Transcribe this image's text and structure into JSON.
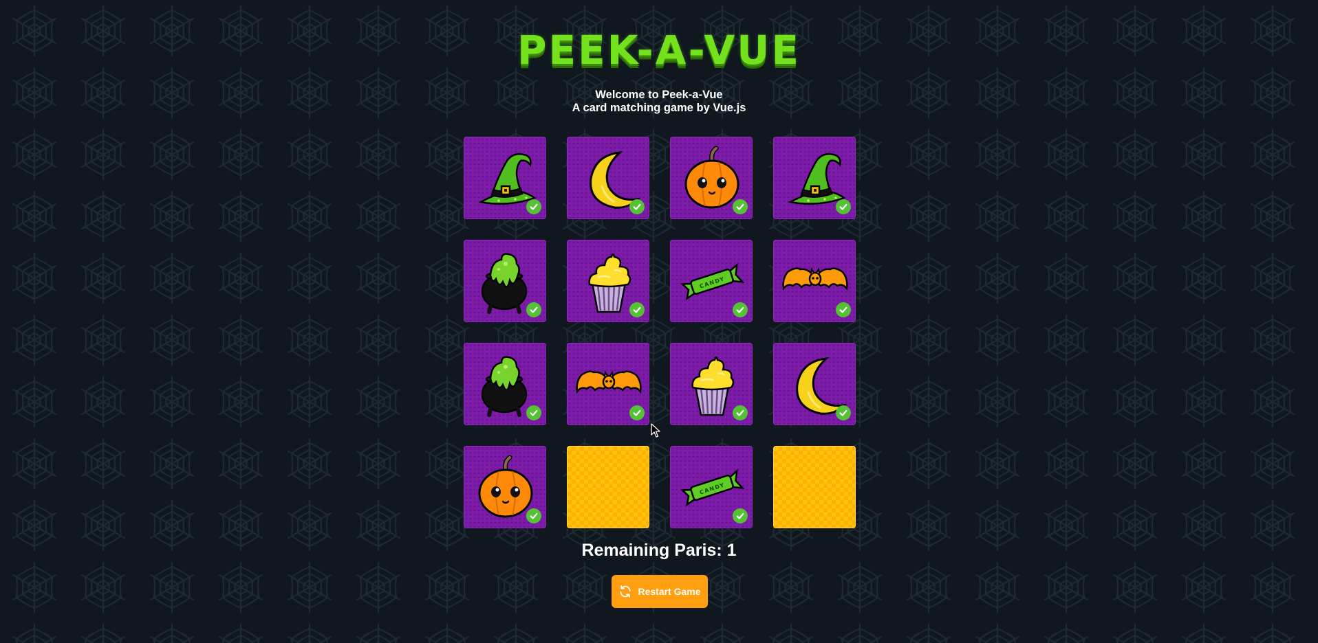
{
  "header": {
    "logo_text": "PEEK-A-VUE"
  },
  "intro": {
    "line1": "Welcome to Peek-a-Vue",
    "line2": "A card matching game by Vue.js"
  },
  "board": {
    "columns": 4,
    "cards": [
      {
        "icon": "witch-hat-icon",
        "state": "matched"
      },
      {
        "icon": "moon-icon",
        "state": "matched"
      },
      {
        "icon": "pumpkin-icon",
        "state": "matched"
      },
      {
        "icon": "witch-hat-icon",
        "state": "matched"
      },
      {
        "icon": "cauldron-icon",
        "state": "matched"
      },
      {
        "icon": "cupcake-icon",
        "state": "matched"
      },
      {
        "icon": "candy-icon",
        "state": "matched"
      },
      {
        "icon": "bat-icon",
        "state": "matched"
      },
      {
        "icon": "cauldron-icon",
        "state": "matched"
      },
      {
        "icon": "bat-icon",
        "state": "matched"
      },
      {
        "icon": "cupcake-icon",
        "state": "matched"
      },
      {
        "icon": "moon-icon",
        "state": "matched"
      },
      {
        "icon": "pumpkin-icon",
        "state": "matched"
      },
      {
        "icon": null,
        "state": "face-down"
      },
      {
        "icon": "candy-icon",
        "state": "matched"
      },
      {
        "icon": null,
        "state": "face-down"
      }
    ],
    "candy_wrapper_text": "CANDY"
  },
  "status": {
    "remaining_text": "Remaining Paris: 1"
  },
  "controls": {
    "restart_label": "Restart Game",
    "restart_icon": "refresh-icon"
  },
  "colors": {
    "background": "#10171e",
    "card_face": "#7d1ca8",
    "card_back": "#ffc40a",
    "check": "#55c235",
    "button": "#ff9f0f",
    "logo": "#73e21c"
  }
}
